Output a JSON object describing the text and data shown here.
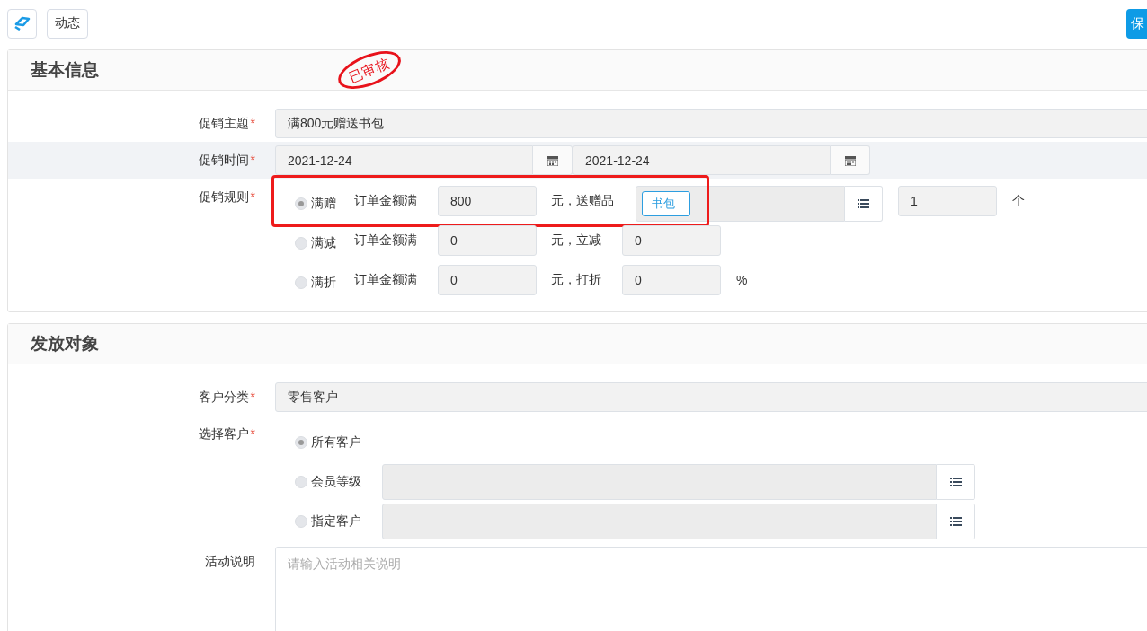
{
  "toolbar": {
    "dynamic_button": "动态",
    "save_button": "保"
  },
  "stamp": "已审核",
  "sections": [
    {
      "title": "基本信息",
      "fields": [
        {
          "kind": "text",
          "label": "促销主题",
          "required": "*",
          "highlighted": false,
          "value": "满800元赠送书包"
        },
        {
          "kind": "daterange",
          "label": "促销时间",
          "required": "*",
          "highlighted": true,
          "start": "2021-12-24",
          "end": "2021-12-24"
        },
        {
          "kind": "rules",
          "label": "促销规则",
          "required": "*",
          "highlighted": false,
          "options": [
            {
              "kind": "gift",
              "label": "满赠",
              "selected": true,
              "marked": true,
              "prefix": "订单金额满",
              "amount": "800",
              "suffix": "元，送赠品",
              "tag": "书包",
              "quantity": "1",
              "unit": "个"
            },
            {
              "kind": "reduce",
              "label": "满减",
              "selected": false,
              "marked": false,
              "prefix": "订单金额满",
              "amount": "0",
              "suffix": "元，立减",
              "value": "0"
            },
            {
              "kind": "percent",
              "label": "满折",
              "selected": false,
              "marked": false,
              "prefix": "订单金额满",
              "amount": "0",
              "suffix": "元，打折",
              "value": "0",
              "unit": "%"
            }
          ]
        }
      ]
    },
    {
      "title": "发放对象",
      "fields": [
        {
          "kind": "text",
          "label": "客户分类",
          "required": "*",
          "highlighted": false,
          "value": "零售客户"
        },
        {
          "kind": "choice",
          "label": "选择客户",
          "required": "*",
          "highlighted": false,
          "options": [
            {
              "kind": "plain",
              "label": "所有客户",
              "selected": true
            },
            {
              "kind": "picker",
              "label": "会员等级",
              "selected": false
            },
            {
              "kind": "picker",
              "label": "指定客户",
              "selected": false
            }
          ]
        },
        {
          "kind": "textarea",
          "label": "活动说明",
          "highlighted": false,
          "placeholder": "请输入活动相关说明"
        }
      ]
    }
  ]
}
